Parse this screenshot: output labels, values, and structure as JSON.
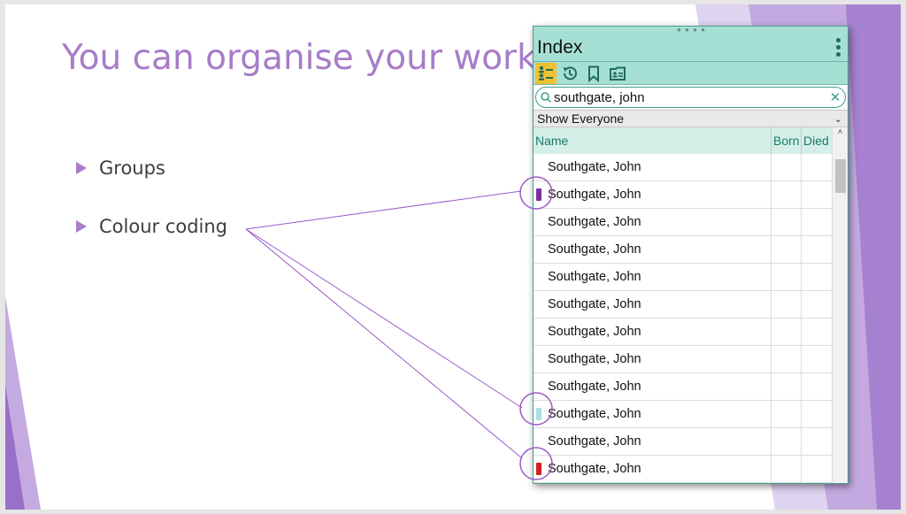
{
  "slide": {
    "title": "You can organise your work",
    "bullets": [
      "Groups",
      "Colour coding"
    ],
    "accent": "#a77dc9"
  },
  "panel": {
    "title": "Index",
    "toolbar_icons": [
      "people-list-icon",
      "history-icon",
      "bookmark-icon",
      "person-card-icon"
    ],
    "search": {
      "value": "southgate, john",
      "placeholder": ""
    },
    "filter": "Show Everyone",
    "columns": [
      "Name",
      "Born",
      "Died"
    ],
    "rows": [
      {
        "name": "Southgate, John",
        "born": "",
        "died": "",
        "color": null
      },
      {
        "name": "Southgate, John",
        "born": "",
        "died": "",
        "color": "#7b2fa0"
      },
      {
        "name": "Southgate, John",
        "born": "",
        "died": "",
        "color": null
      },
      {
        "name": "Southgate, John",
        "born": "",
        "died": "",
        "color": null
      },
      {
        "name": "Southgate, John",
        "born": "",
        "died": "",
        "color": null
      },
      {
        "name": "Southgate, John",
        "born": "",
        "died": "",
        "color": null
      },
      {
        "name": "Southgate, John",
        "born": "",
        "died": "",
        "color": null
      },
      {
        "name": "Southgate, John",
        "born": "",
        "died": "",
        "color": null
      },
      {
        "name": "Southgate, John",
        "born": "",
        "died": "",
        "color": null
      },
      {
        "name": "Southgate, John",
        "born": "",
        "died": "",
        "color": "#a8dfe6"
      },
      {
        "name": "Southgate, John",
        "born": "",
        "died": "",
        "color": null
      },
      {
        "name": "Southgate, John",
        "born": "",
        "died": "",
        "color": "#d42020"
      }
    ],
    "colors": {
      "header_bg": "#a6dfd3",
      "active_tool": "#f2c12e",
      "column_text": "#1b7a6b"
    }
  }
}
